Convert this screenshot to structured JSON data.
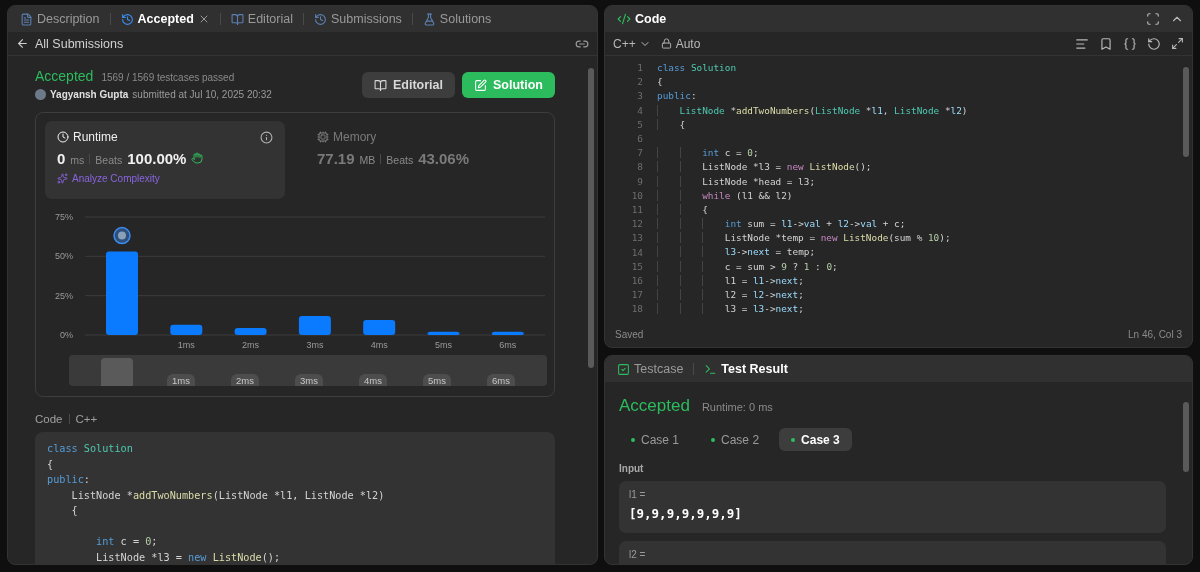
{
  "left_tabs": [
    {
      "label": "Description",
      "selected": false
    },
    {
      "label": "Accepted",
      "selected": true
    },
    {
      "label": "Editorial",
      "selected": false
    },
    {
      "label": "Submissions",
      "selected": false
    },
    {
      "label": "Solutions",
      "selected": false
    }
  ],
  "back_link": "All Submissions",
  "submission": {
    "status": "Accepted",
    "testcases": "1569 / 1569 testcases passed",
    "author": "Yagyansh Gupta",
    "submitted": "submitted at Jul 10, 2025 20:32",
    "buttons": [
      {
        "label": "Editorial",
        "kind": "secondary"
      },
      {
        "label": "Solution",
        "kind": "primary"
      }
    ]
  },
  "stats": [
    {
      "title": "Runtime",
      "selected": true,
      "value": "0",
      "unit": "ms",
      "beats_label": "Beats",
      "beats": "100.00%",
      "action": "Analyze Complexity"
    },
    {
      "title": "Memory",
      "selected": false,
      "value": "77.19",
      "unit": "MB",
      "beats_label": "Beats",
      "beats": "43.06%"
    }
  ],
  "chart_data": {
    "type": "bar",
    "categories": [
      null,
      "1ms",
      "2ms",
      "3ms",
      "4ms",
      "5ms",
      "6ms"
    ],
    "series": [
      {
        "color": "#0a7aff",
        "values": [
          53,
          6.5,
          4.5,
          12,
          9.5,
          2,
          2
        ]
      }
    ],
    "ylim": [
      0,
      75
    ],
    "yticks": [
      {
        "value": 0,
        "label": "0%"
      },
      {
        "value": 25,
        "label": "25%"
      },
      {
        "value": 50,
        "label": "50%"
      },
      {
        "value": 75,
        "label": "75%"
      }
    ]
  },
  "overview": [
    {
      "selected": true
    },
    {
      "label": "1ms",
      "selected": false
    },
    {
      "label": "2ms",
      "selected": false
    },
    {
      "label": "3ms",
      "selected": false
    },
    {
      "label": "4ms",
      "selected": false
    },
    {
      "label": "5ms",
      "selected": false
    },
    {
      "label": "6ms",
      "selected": false
    }
  ],
  "code_section": {
    "label": "Code",
    "language": "C++",
    "lines": [
      {
        "kind": "code",
        "tokens": [
          {
            "text": "class ",
            "kind": "keyword"
          },
          {
            "text": "Solution",
            "kind": "type"
          }
        ]
      },
      {
        "kind": "code",
        "tokens": [
          {
            "text": "{",
            "kind": "plain"
          }
        ]
      },
      {
        "kind": "code",
        "tokens": [
          {
            "text": "public",
            "kind": "keyword"
          },
          {
            "text": ":",
            "kind": "plain"
          }
        ]
      },
      {
        "kind": "code",
        "tokens": [
          {
            "text": "    ListNode *",
            "kind": "plain"
          },
          {
            "text": "addTwoNumbers",
            "kind": "function"
          },
          {
            "text": "(ListNode *l1, ListNode *l2)",
            "kind": "plain"
          }
        ]
      },
      {
        "kind": "code",
        "tokens": [
          {
            "text": "    {",
            "kind": "plain"
          }
        ]
      },
      {
        "kind": "blank"
      },
      {
        "kind": "code",
        "tokens": [
          {
            "text": "        int",
            "kind": "keyword"
          },
          {
            "text": " c = ",
            "kind": "plain"
          },
          {
            "text": "0",
            "kind": "number"
          },
          {
            "text": ";",
            "kind": "plain"
          }
        ]
      },
      {
        "kind": "code",
        "tokens": [
          {
            "text": "        ListNode *l3 = ",
            "kind": "plain"
          },
          {
            "text": "new",
            "kind": "keyword"
          },
          {
            "text": " ListNode",
            "kind": "function"
          },
          {
            "text": "();",
            "kind": "plain"
          }
        ]
      }
    ]
  },
  "editor": {
    "title": "Code",
    "language": "C++",
    "mode": "Auto",
    "status": "Saved",
    "cursor": "Ln 46, Col 3",
    "lines": [
      {
        "n": "1",
        "kind": "code",
        "tokens": [
          {
            "text": "class ",
            "kind": "keyword"
          },
          {
            "text": "Solution",
            "kind": "type"
          }
        ]
      },
      {
        "n": "2",
        "kind": "code",
        "tokens": [
          {
            "text": "{",
            "kind": "plain"
          }
        ]
      },
      {
        "n": "3",
        "kind": "code",
        "tokens": [
          {
            "text": "public",
            "kind": "keyword"
          },
          {
            "text": ":",
            "kind": "plain"
          }
        ]
      },
      {
        "n": "4",
        "kind": "code",
        "tokens": [
          {
            "text": "    ListNode",
            "kind": "type"
          },
          {
            "text": " *",
            "kind": "plain"
          },
          {
            "text": "addTwoNumbers",
            "kind": "function"
          },
          {
            "text": "(",
            "kind": "plain"
          },
          {
            "text": "ListNode",
            "kind": "type"
          },
          {
            "text": " *",
            "kind": "plain"
          },
          {
            "text": "l1",
            "kind": "variable"
          },
          {
            "text": ", ",
            "kind": "plain"
          },
          {
            "text": "ListNode",
            "kind": "type"
          },
          {
            "text": " *",
            "kind": "plain"
          },
          {
            "text": "l2",
            "kind": "variable"
          },
          {
            "text": ")",
            "kind": "plain"
          }
        ]
      },
      {
        "n": "5",
        "kind": "code",
        "tokens": [
          {
            "text": "    {",
            "kind": "plain"
          }
        ]
      },
      {
        "n": "6",
        "kind": "blank"
      },
      {
        "n": "7",
        "kind": "code",
        "tokens": [
          {
            "text": "        int",
            "kind": "keyword"
          },
          {
            "text": " c = ",
            "kind": "plain"
          },
          {
            "text": "0",
            "kind": "number"
          },
          {
            "text": ";",
            "kind": "plain"
          }
        ]
      },
      {
        "n": "8",
        "kind": "code",
        "tokens": [
          {
            "text": "        ListNode *l3 = ",
            "kind": "plain"
          },
          {
            "text": "new",
            "kind": "control"
          },
          {
            "text": " ListNode",
            "kind": "function"
          },
          {
            "text": "();",
            "kind": "plain"
          }
        ]
      },
      {
        "n": "9",
        "kind": "code",
        "tokens": [
          {
            "text": "        ListNode *head = l3;",
            "kind": "plain"
          }
        ]
      },
      {
        "n": "10",
        "kind": "code",
        "tokens": [
          {
            "text": "        while",
            "kind": "control"
          },
          {
            "text": " (l1 && l2)",
            "kind": "plain"
          }
        ]
      },
      {
        "n": "11",
        "kind": "code",
        "tokens": [
          {
            "text": "        {",
            "kind": "plain"
          }
        ]
      },
      {
        "n": "12",
        "kind": "code",
        "tokens": [
          {
            "text": "            int",
            "kind": "keyword"
          },
          {
            "text": " sum = ",
            "kind": "plain"
          },
          {
            "text": "l1",
            "kind": "variable"
          },
          {
            "text": "->",
            "kind": "plain"
          },
          {
            "text": "val",
            "kind": "variable"
          },
          {
            "text": " + ",
            "kind": "plain"
          },
          {
            "text": "l2",
            "kind": "variable"
          },
          {
            "text": "->",
            "kind": "plain"
          },
          {
            "text": "val",
            "kind": "variable"
          },
          {
            "text": " + c;",
            "kind": "plain"
          }
        ]
      },
      {
        "n": "13",
        "kind": "code",
        "tokens": [
          {
            "text": "            ListNode *temp = ",
            "kind": "plain"
          },
          {
            "text": "new",
            "kind": "control"
          },
          {
            "text": " ListNode",
            "kind": "function"
          },
          {
            "text": "(sum % ",
            "kind": "plain"
          },
          {
            "text": "10",
            "kind": "number"
          },
          {
            "text": ");",
            "kind": "plain"
          }
        ]
      },
      {
        "n": "14",
        "kind": "code",
        "tokens": [
          {
            "text": "            l3",
            "kind": "variable"
          },
          {
            "text": "->",
            "kind": "plain"
          },
          {
            "text": "next",
            "kind": "variable"
          },
          {
            "text": " = temp;",
            "kind": "plain"
          }
        ]
      },
      {
        "n": "15",
        "kind": "code",
        "tokens": [
          {
            "text": "            c = sum > ",
            "kind": "plain"
          },
          {
            "text": "9",
            "kind": "number"
          },
          {
            "text": " ? ",
            "kind": "plain"
          },
          {
            "text": "1",
            "kind": "number"
          },
          {
            "text": " : ",
            "kind": "plain"
          },
          {
            "text": "0",
            "kind": "number"
          },
          {
            "text": ";",
            "kind": "plain"
          }
        ]
      },
      {
        "n": "16",
        "kind": "code",
        "tokens": [
          {
            "text": "            l1 = ",
            "kind": "plain"
          },
          {
            "text": "l1",
            "kind": "variable"
          },
          {
            "text": "->",
            "kind": "plain"
          },
          {
            "text": "next",
            "kind": "variable"
          },
          {
            "text": ";",
            "kind": "plain"
          }
        ]
      },
      {
        "n": "17",
        "kind": "code",
        "tokens": [
          {
            "text": "            l2 = ",
            "kind": "plain"
          },
          {
            "text": "l2",
            "kind": "variable"
          },
          {
            "text": "->",
            "kind": "plain"
          },
          {
            "text": "next",
            "kind": "variable"
          },
          {
            "text": ";",
            "kind": "plain"
          }
        ]
      },
      {
        "n": "18",
        "kind": "code",
        "tokens": [
          {
            "text": "            l3 = ",
            "kind": "plain"
          },
          {
            "text": "l3",
            "kind": "variable"
          },
          {
            "text": "->",
            "kind": "plain"
          },
          {
            "text": "next",
            "kind": "variable"
          },
          {
            "text": ";",
            "kind": "plain"
          }
        ]
      }
    ]
  },
  "console": {
    "tabs": [
      {
        "label": "Testcase",
        "selected": false
      },
      {
        "label": "Test Result",
        "selected": true
      }
    ],
    "status": "Accepted",
    "runtime": "Runtime: 0 ms",
    "cases": [
      {
        "label": "Case 1",
        "selected": false,
        "passed": true
      },
      {
        "label": "Case 2",
        "selected": false,
        "passed": true
      },
      {
        "label": "Case 3",
        "selected": true,
        "passed": true
      }
    ],
    "input_label": "Input",
    "inputs": [
      {
        "name": "l1 =",
        "value": "[9,9,9,9,9,9,9]"
      },
      {
        "name": "l2 ="
      }
    ]
  }
}
